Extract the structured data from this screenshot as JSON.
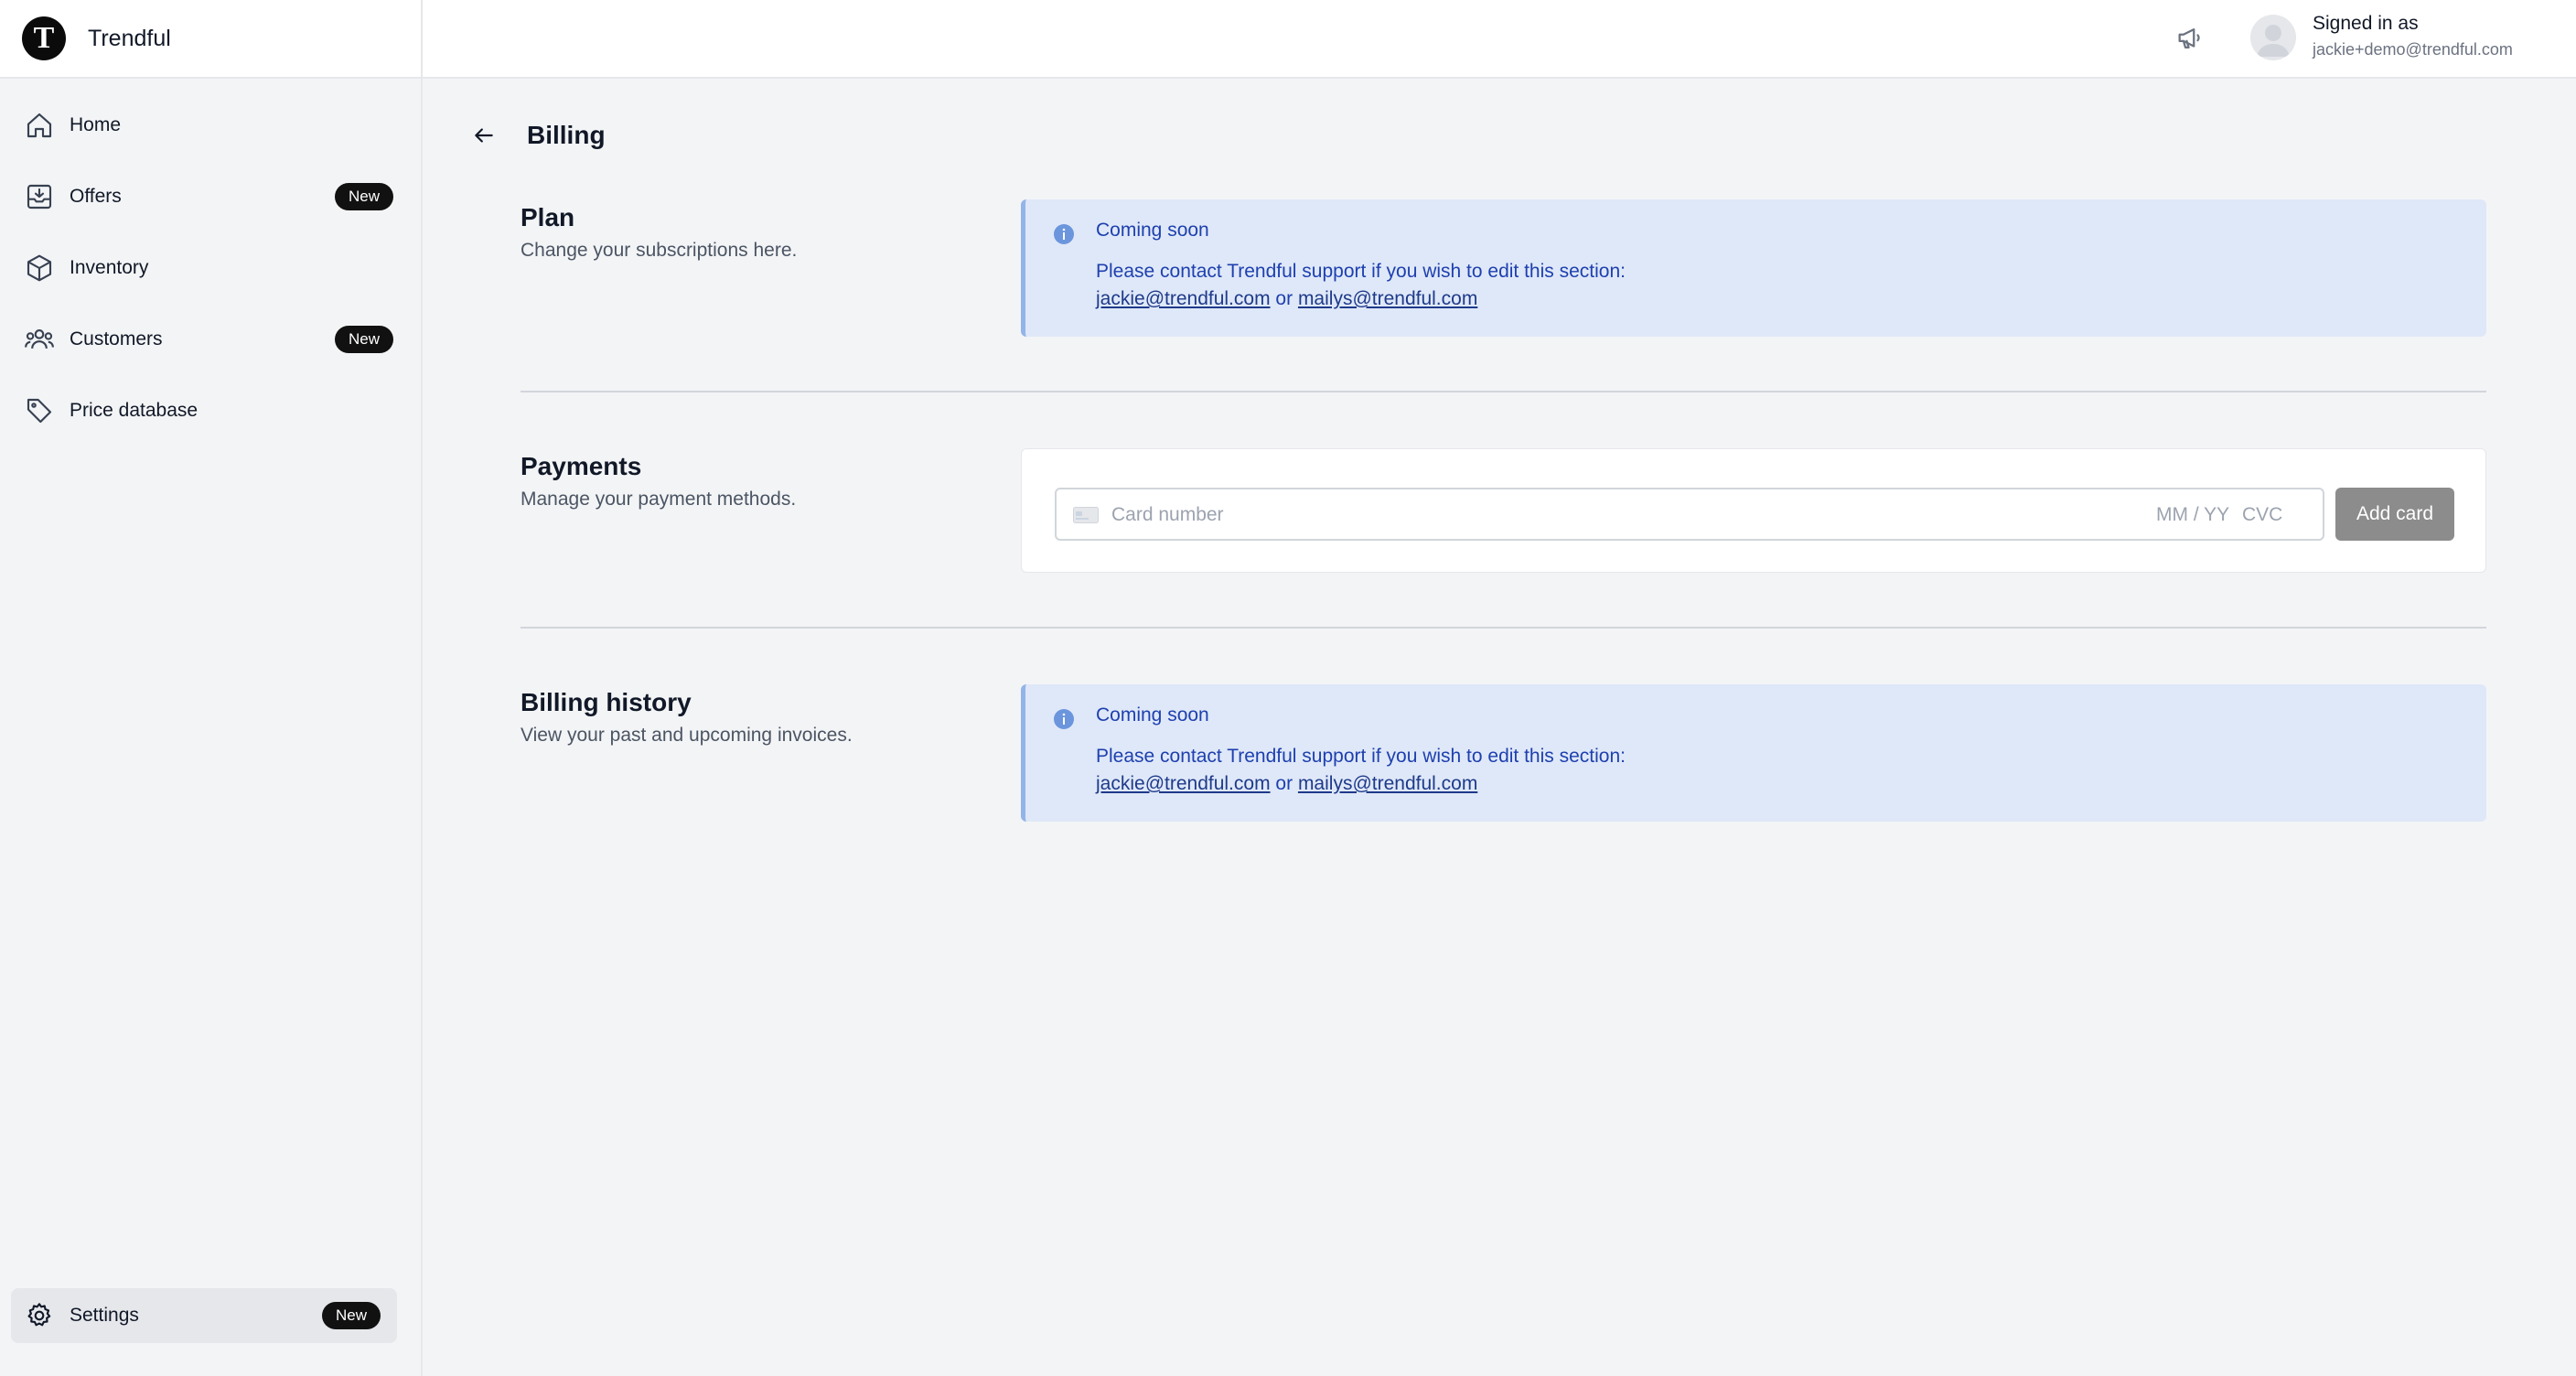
{
  "brand": {
    "name": "Trendful",
    "logo_letter": "T"
  },
  "sidebar": {
    "items": [
      {
        "label": "Home",
        "icon": "home-icon",
        "badge": ""
      },
      {
        "label": "Offers",
        "icon": "inbox-download-icon",
        "badge": "New"
      },
      {
        "label": "Inventory",
        "icon": "cube-icon",
        "badge": ""
      },
      {
        "label": "Customers",
        "icon": "users-icon",
        "badge": "New"
      },
      {
        "label": "Price database",
        "icon": "tag-icon",
        "badge": ""
      }
    ],
    "settings": {
      "label": "Settings",
      "icon": "gear-icon",
      "badge": "New"
    }
  },
  "header": {
    "signed_in_label": "Signed in as",
    "user_email": "jackie+demo@trendful.com",
    "announcement_icon": "megaphone-icon"
  },
  "page": {
    "title": "Billing"
  },
  "sections": {
    "plan": {
      "title": "Plan",
      "description": "Change your subscriptions here.",
      "alert": {
        "title": "Coming soon",
        "message": "Please contact Trendful support if you wish to edit this section:",
        "email1": "jackie@trendful.com",
        "connector": "or",
        "email2": "mailys@trendful.com"
      }
    },
    "payments": {
      "title": "Payments",
      "description": "Manage your payment methods.",
      "card_placeholder": "Card number",
      "expiry_placeholder": "MM / YY",
      "cvc_placeholder": "CVC",
      "add_button": "Add card"
    },
    "history": {
      "title": "Billing history",
      "description": "View your past and upcoming invoices.",
      "alert": {
        "title": "Coming soon",
        "message": "Please contact Trendful support if you wish to edit this section:",
        "email1": "jackie@trendful.com",
        "connector": "or",
        "email2": "mailys@trendful.com"
      }
    }
  },
  "colors": {
    "accent_blue": "#1e40af",
    "alert_bg": "#dfe8f8",
    "badge_bg": "#111111"
  }
}
